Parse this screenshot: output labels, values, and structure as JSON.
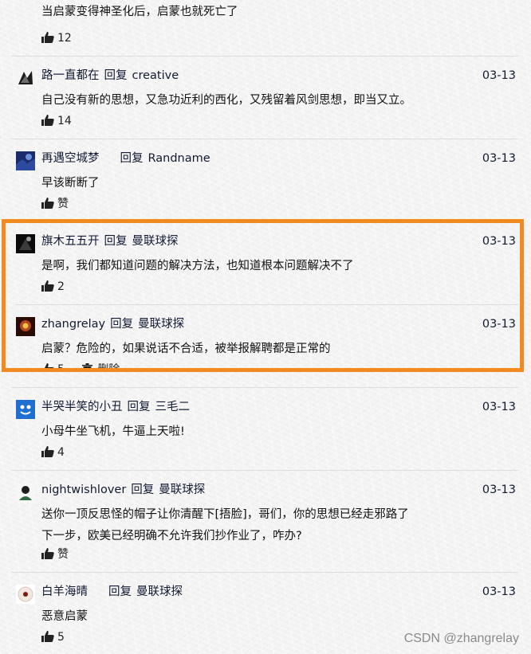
{
  "comments": [
    {
      "body": "当启蒙变得神圣化后，启蒙也就死亡了",
      "likes": "12"
    },
    {
      "user": "路一直都在",
      "reply_word": "回复",
      "target": "creative",
      "date": "03-13",
      "body": "自己没有新的思想，又急功近利的西化，又残留着风剑思想，即当又立。",
      "likes": "14"
    },
    {
      "user": "再遇空城梦",
      "reply_word": "回复",
      "target": "Randname",
      "date": "03-13",
      "body": "早该断断了",
      "likes": "赞"
    },
    {
      "user": "旗木五五开",
      "reply_word": "回复",
      "target": "曼联球探",
      "date": "03-13",
      "body": "是啊，我们都知道问题的解决方法，也知道根本问题解决不了",
      "likes": "2"
    },
    {
      "user": "zhangrelay",
      "reply_word": "回复",
      "target": "曼联球探",
      "date": "03-13",
      "body": "启蒙？危险的，如果说话不合适，被举报解聘都是正常的",
      "likes": "5",
      "delete_label": "删除"
    },
    {
      "user": "半哭半笑的小丑",
      "reply_word": "回复",
      "target": "三毛二",
      "date": "03-13",
      "body": "小母牛坐飞机，牛逼上天啦!",
      "likes": "4"
    },
    {
      "user": "nightwishlover",
      "reply_word": "回复",
      "target": "曼联球探",
      "date": "03-13",
      "body_line1": "送你一顶反思怪的帽子让你清醒下[捂脸]，哥们，你的思想已经走邪路了",
      "body_line2": "下一步，欧美已经明确不允许我们抄作业了，咋办?",
      "likes": "赞"
    },
    {
      "user": "白羊海晴",
      "reply_word": "回复",
      "target": "曼联球探",
      "date": "03-13",
      "body": "恶意启蒙",
      "likes": "5"
    }
  ],
  "watermark": "CSDN @zhangrelay",
  "colors": {
    "highlight_border": "#f28a22",
    "link_text": "#121a33",
    "divider": "#dcdcdc"
  },
  "icons": {
    "like": "thumbs-up-icon",
    "delete": "trash-icon"
  }
}
